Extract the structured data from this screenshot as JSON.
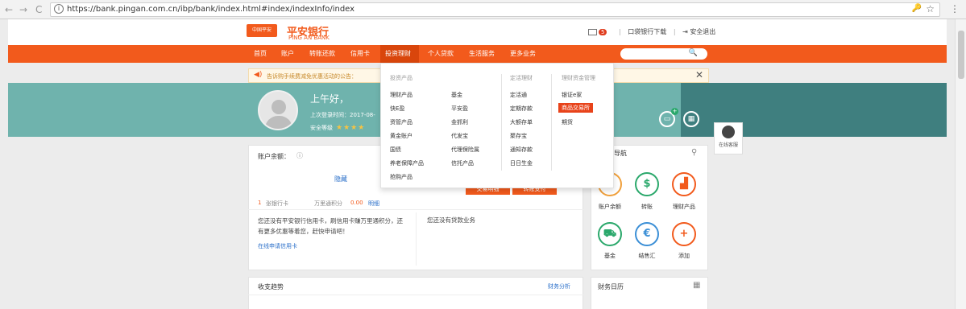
{
  "browser": {
    "back": "←",
    "forward": "→",
    "reload": "C",
    "url": "https://bank.pingan.com.cn/ibp/bank/index.html#index/indexInfo/index",
    "star": "☆",
    "key": "🔑",
    "menu": "⋮"
  },
  "header": {
    "logo_box": "中国平安",
    "brand_cn": "平安银行",
    "brand_en": "PING AN BANK",
    "mail_count": "5",
    "app_download": "口袋银行下载",
    "logout": "安全退出"
  },
  "nav": {
    "items": [
      "首页",
      "账户",
      "转账还款",
      "信用卡",
      "投资理财",
      "个人贷款",
      "生活服务",
      "更多业务"
    ],
    "active": "投资理财"
  },
  "notice": {
    "text": "告诉购手续费减免优惠活动的公告："
  },
  "banner": {
    "greeting": "上午好，",
    "last_login": "上次登录时间：2017-08-",
    "safety_level": "安全等级",
    "stars": "★★★★"
  },
  "dropdown": {
    "col1_title": "投资产品",
    "col1_items": [
      "理财产品",
      "快E盈",
      "资管产品",
      "黄金账户",
      "国债",
      "养老保障产品",
      "抢购产品"
    ],
    "col2_items": [
      "基金",
      "平安盈",
      "金抓利",
      "代发宝",
      "代理保险属",
      "信托产品"
    ],
    "col3_title": "定活理财",
    "col3_items": [
      "定活通",
      "定期存款",
      "大额存单",
      "聚存宝",
      "通知存款",
      "日日生金"
    ],
    "col4_title": "理财资金管理",
    "col4_items": [
      "银证e家",
      "商品交易所",
      "期货"
    ],
    "highlighted": "商品交易所"
  },
  "account": {
    "title": "账户余额：",
    "hide": "隐藏",
    "card_count": "1",
    "card_label": "张银行卡",
    "points_label": "万里通积分",
    "points_value": "0.00",
    "points_link": "明细",
    "btn1": "交易明细",
    "btn2": "转账支付",
    "credit_text": "您还没有平安银行信用卡，刷信用卡赚万里通积分，还有更多优惠等着您，赶快申请吧！",
    "credit_link": "在线申请信用卡",
    "loan_text": "您还没有贷款业务"
  },
  "quicknav": {
    "title": "导航",
    "items": [
      {
        "label": "账户余额",
        "icon": "wallet-icon",
        "glyph": "¥",
        "color": "#f0a03c"
      },
      {
        "label": "转账",
        "icon": "transfer-icon",
        "glyph": "$",
        "color": "#2aa86b"
      },
      {
        "label": "理财产品",
        "icon": "chart-icon",
        "glyph": "▟",
        "color": "#f25a1c"
      },
      {
        "label": "基金",
        "icon": "cart-icon",
        "glyph": "⛟",
        "color": "#2aa86b"
      },
      {
        "label": "结售汇",
        "icon": "exchange-icon",
        "glyph": "€",
        "color": "#3b8fd6"
      },
      {
        "label": "添加",
        "icon": "add-icon",
        "glyph": "+",
        "color": "#f25a1c"
      }
    ]
  },
  "income": {
    "title": "收支趋势",
    "link": "财务分析"
  },
  "calendar": {
    "title": "财务日历"
  },
  "service": {
    "label": "在线客服"
  },
  "colors": {
    "brand_orange": "#f25a1c",
    "banner_teal": "#6fb3ad"
  }
}
